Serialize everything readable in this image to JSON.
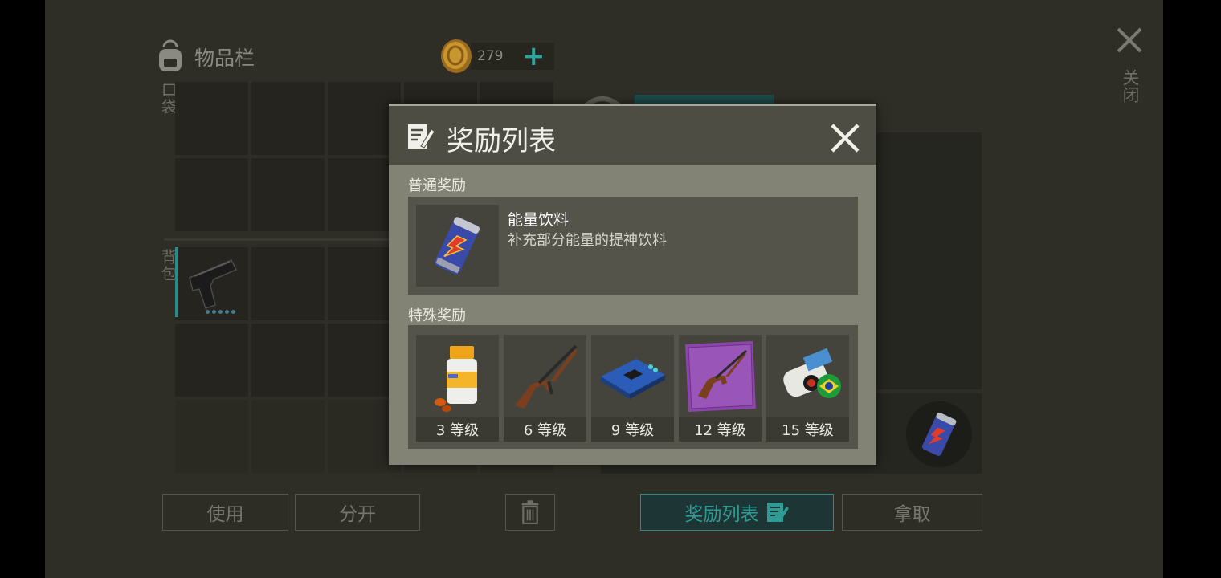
{
  "inventory": {
    "title": "物品栏",
    "pocket_label": "口袋",
    "backpack_label": "背包"
  },
  "currency": {
    "amount": "279",
    "add_symbol": "+"
  },
  "window": {
    "close_label": "关闭"
  },
  "bottom_buttons": {
    "use": "使用",
    "split": "分开",
    "reward_list": "奖励列表",
    "take": "拿取"
  },
  "modal": {
    "title": "奖励列表",
    "normal_section": "普通奖励",
    "normal_item": {
      "name": "能量饮料",
      "description": "补充部分能量的提神饮料",
      "icon": "energy-drink-icon"
    },
    "special_section": "特殊奖励",
    "special_items": [
      {
        "icon": "vitamin-bottle-icon",
        "level": "3 等级"
      },
      {
        "icon": "assault-rifle-icon",
        "level": "6 等级"
      },
      {
        "icon": "circuit-board-icon",
        "level": "9 等级"
      },
      {
        "icon": "rifle-blueprint-icon",
        "level": "12 等级"
      },
      {
        "icon": "brazil-skin-item-icon",
        "level": "15 等级"
      }
    ]
  },
  "colors": {
    "accent_teal": "#2a8b87",
    "modal_bg": "#828275",
    "modal_header": "#4d4d44"
  }
}
